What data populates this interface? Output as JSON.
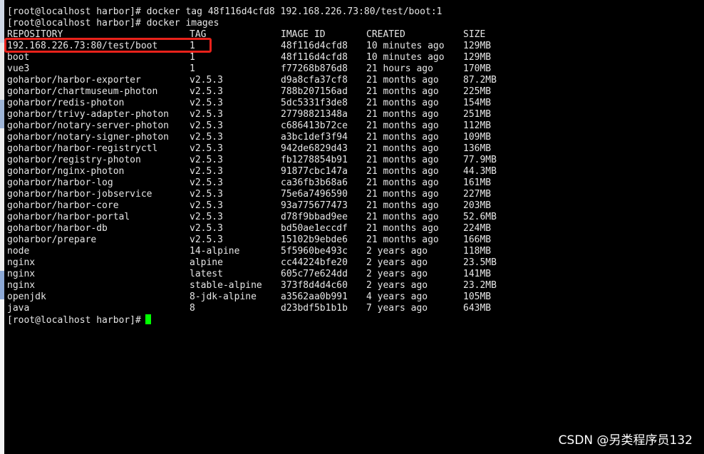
{
  "commands": {
    "tag": "[root@localhost harbor]# docker tag 48f116d4cfd8 192.168.226.73:80/test/boot:1",
    "images": "[root@localhost harbor]# docker images",
    "prompt": "[root@localhost harbor]#"
  },
  "table": {
    "headers": [
      "REPOSITORY",
      "TAG",
      "IMAGE ID",
      "CREATED",
      "SIZE"
    ],
    "rows": [
      [
        "192.168.226.73:80/test/boot",
        "1",
        "48f116d4cfd8",
        "10 minutes ago",
        "129MB"
      ],
      [
        "boot",
        "1",
        "48f116d4cfd8",
        "10 minutes ago",
        "129MB"
      ],
      [
        "vue3",
        "1",
        "f77268b876d8",
        "21 hours ago",
        "170MB"
      ],
      [
        "goharbor/harbor-exporter",
        "v2.5.3",
        "d9a8cfa37cf8",
        "21 months ago",
        "87.2MB"
      ],
      [
        "goharbor/chartmuseum-photon",
        "v2.5.3",
        "788b207156ad",
        "21 months ago",
        "225MB"
      ],
      [
        "goharbor/redis-photon",
        "v2.5.3",
        "5dc5331f3de8",
        "21 months ago",
        "154MB"
      ],
      [
        "goharbor/trivy-adapter-photon",
        "v2.5.3",
        "27798821348a",
        "21 months ago",
        "251MB"
      ],
      [
        "goharbor/notary-server-photon",
        "v2.5.3",
        "c686413b72ce",
        "21 months ago",
        "112MB"
      ],
      [
        "goharbor/notary-signer-photon",
        "v2.5.3",
        "a3bc1def3f94",
        "21 months ago",
        "109MB"
      ],
      [
        "goharbor/harbor-registryctl",
        "v2.5.3",
        "942de6829d43",
        "21 months ago",
        "136MB"
      ],
      [
        "goharbor/registry-photon",
        "v2.5.3",
        "fb1278854b91",
        "21 months ago",
        "77.9MB"
      ],
      [
        "goharbor/nginx-photon",
        "v2.5.3",
        "91877cbc147a",
        "21 months ago",
        "44.3MB"
      ],
      [
        "goharbor/harbor-log",
        "v2.5.3",
        "ca36fb3b68a6",
        "21 months ago",
        "161MB"
      ],
      [
        "goharbor/harbor-jobservice",
        "v2.5.3",
        "75e6a7496590",
        "21 months ago",
        "227MB"
      ],
      [
        "goharbor/harbor-core",
        "v2.5.3",
        "93a775677473",
        "21 months ago",
        "203MB"
      ],
      [
        "goharbor/harbor-portal",
        "v2.5.3",
        "d78f9bbad9ee",
        "21 months ago",
        "52.6MB"
      ],
      [
        "goharbor/harbor-db",
        "v2.5.3",
        "bd50ae1eccdf",
        "21 months ago",
        "224MB"
      ],
      [
        "goharbor/prepare",
        "v2.5.3",
        "15102b9ebde6",
        "21 months ago",
        "166MB"
      ],
      [
        "node",
        "14-alpine",
        "5f5960be493c",
        "2 years ago",
        "118MB"
      ],
      [
        "nginx",
        "alpine",
        "cc44224bfe20",
        "2 years ago",
        "23.5MB"
      ],
      [
        "nginx",
        "latest",
        "605c77e624dd",
        "2 years ago",
        "141MB"
      ],
      [
        "nginx",
        "stable-alpine",
        "373f8d4d4c60",
        "2 years ago",
        "23.2MB"
      ],
      [
        "openjdk",
        "8-jdk-alpine",
        "a3562aa0b991",
        "4 years ago",
        "105MB"
      ],
      [
        "java",
        "8",
        "d23bdf5b1b1b",
        "7 years ago",
        "643MB"
      ]
    ]
  },
  "highlight": {
    "color": "#e8221b"
  },
  "cursor": {
    "color": "#00ff00"
  },
  "watermark": "CSDN @另类程序员132"
}
